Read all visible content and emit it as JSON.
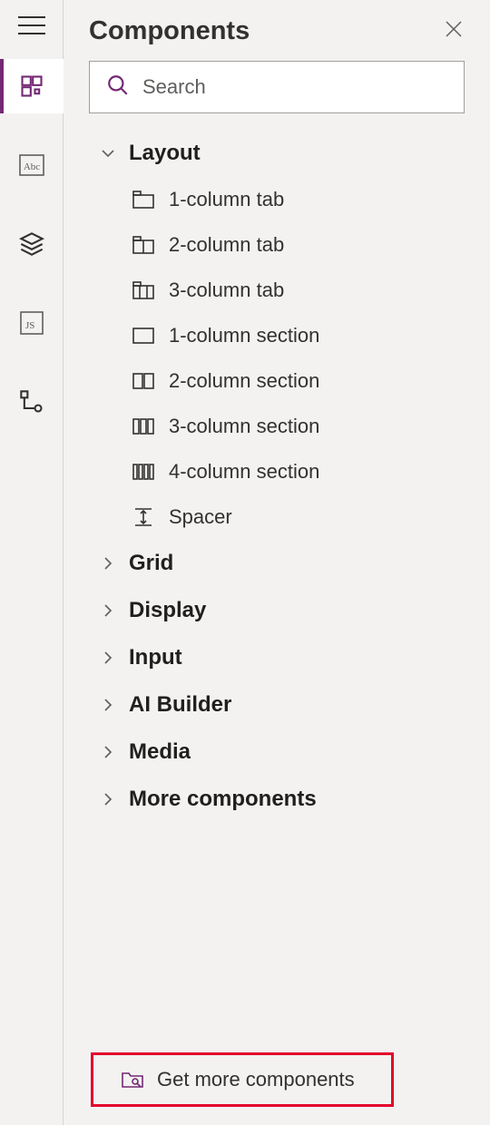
{
  "panel": {
    "title": "Components"
  },
  "search": {
    "placeholder": "Search"
  },
  "groups": {
    "layout": {
      "label": "Layout",
      "items": {
        "col1tab": "1-column tab",
        "col2tab": "2-column tab",
        "col3tab": "3-column tab",
        "col1sec": "1-column section",
        "col2sec": "2-column section",
        "col3sec": "3-column section",
        "col4sec": "4-column section",
        "spacer": "Spacer"
      }
    },
    "grid": {
      "label": "Grid"
    },
    "display": {
      "label": "Display"
    },
    "input": {
      "label": "Input"
    },
    "aibuilder": {
      "label": "AI Builder"
    },
    "media": {
      "label": "Media"
    },
    "more": {
      "label": "More components"
    }
  },
  "footer": {
    "get_more": "Get more components"
  }
}
